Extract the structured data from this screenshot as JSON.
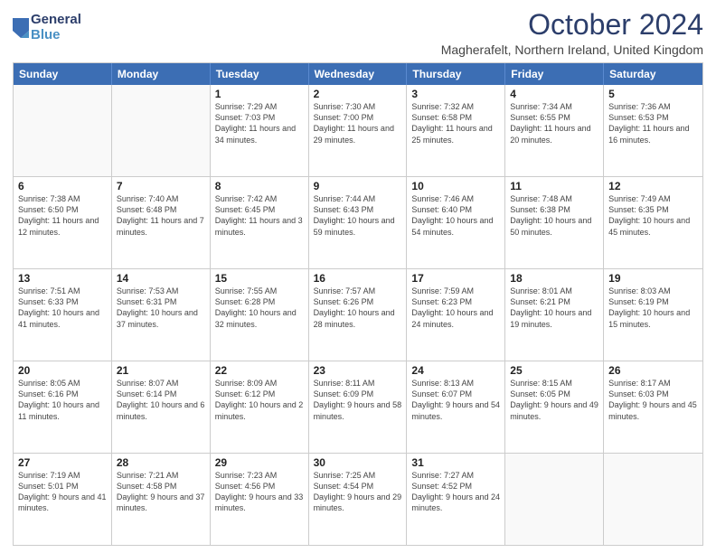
{
  "logo": {
    "general": "General",
    "blue": "Blue"
  },
  "title": "October 2024",
  "subtitle": "Magherafelt, Northern Ireland, United Kingdom",
  "headers": [
    "Sunday",
    "Monday",
    "Tuesday",
    "Wednesday",
    "Thursday",
    "Friday",
    "Saturday"
  ],
  "weeks": [
    [
      {
        "day": "",
        "sunrise": "",
        "sunset": "",
        "daylight": ""
      },
      {
        "day": "",
        "sunrise": "",
        "sunset": "",
        "daylight": ""
      },
      {
        "day": "1",
        "sunrise": "Sunrise: 7:29 AM",
        "sunset": "Sunset: 7:03 PM",
        "daylight": "Daylight: 11 hours and 34 minutes."
      },
      {
        "day": "2",
        "sunrise": "Sunrise: 7:30 AM",
        "sunset": "Sunset: 7:00 PM",
        "daylight": "Daylight: 11 hours and 29 minutes."
      },
      {
        "day": "3",
        "sunrise": "Sunrise: 7:32 AM",
        "sunset": "Sunset: 6:58 PM",
        "daylight": "Daylight: 11 hours and 25 minutes."
      },
      {
        "day": "4",
        "sunrise": "Sunrise: 7:34 AM",
        "sunset": "Sunset: 6:55 PM",
        "daylight": "Daylight: 11 hours and 20 minutes."
      },
      {
        "day": "5",
        "sunrise": "Sunrise: 7:36 AM",
        "sunset": "Sunset: 6:53 PM",
        "daylight": "Daylight: 11 hours and 16 minutes."
      }
    ],
    [
      {
        "day": "6",
        "sunrise": "Sunrise: 7:38 AM",
        "sunset": "Sunset: 6:50 PM",
        "daylight": "Daylight: 11 hours and 12 minutes."
      },
      {
        "day": "7",
        "sunrise": "Sunrise: 7:40 AM",
        "sunset": "Sunset: 6:48 PM",
        "daylight": "Daylight: 11 hours and 7 minutes."
      },
      {
        "day": "8",
        "sunrise": "Sunrise: 7:42 AM",
        "sunset": "Sunset: 6:45 PM",
        "daylight": "Daylight: 11 hours and 3 minutes."
      },
      {
        "day": "9",
        "sunrise": "Sunrise: 7:44 AM",
        "sunset": "Sunset: 6:43 PM",
        "daylight": "Daylight: 10 hours and 59 minutes."
      },
      {
        "day": "10",
        "sunrise": "Sunrise: 7:46 AM",
        "sunset": "Sunset: 6:40 PM",
        "daylight": "Daylight: 10 hours and 54 minutes."
      },
      {
        "day": "11",
        "sunrise": "Sunrise: 7:48 AM",
        "sunset": "Sunset: 6:38 PM",
        "daylight": "Daylight: 10 hours and 50 minutes."
      },
      {
        "day": "12",
        "sunrise": "Sunrise: 7:49 AM",
        "sunset": "Sunset: 6:35 PM",
        "daylight": "Daylight: 10 hours and 45 minutes."
      }
    ],
    [
      {
        "day": "13",
        "sunrise": "Sunrise: 7:51 AM",
        "sunset": "Sunset: 6:33 PM",
        "daylight": "Daylight: 10 hours and 41 minutes."
      },
      {
        "day": "14",
        "sunrise": "Sunrise: 7:53 AM",
        "sunset": "Sunset: 6:31 PM",
        "daylight": "Daylight: 10 hours and 37 minutes."
      },
      {
        "day": "15",
        "sunrise": "Sunrise: 7:55 AM",
        "sunset": "Sunset: 6:28 PM",
        "daylight": "Daylight: 10 hours and 32 minutes."
      },
      {
        "day": "16",
        "sunrise": "Sunrise: 7:57 AM",
        "sunset": "Sunset: 6:26 PM",
        "daylight": "Daylight: 10 hours and 28 minutes."
      },
      {
        "day": "17",
        "sunrise": "Sunrise: 7:59 AM",
        "sunset": "Sunset: 6:23 PM",
        "daylight": "Daylight: 10 hours and 24 minutes."
      },
      {
        "day": "18",
        "sunrise": "Sunrise: 8:01 AM",
        "sunset": "Sunset: 6:21 PM",
        "daylight": "Daylight: 10 hours and 19 minutes."
      },
      {
        "day": "19",
        "sunrise": "Sunrise: 8:03 AM",
        "sunset": "Sunset: 6:19 PM",
        "daylight": "Daylight: 10 hours and 15 minutes."
      }
    ],
    [
      {
        "day": "20",
        "sunrise": "Sunrise: 8:05 AM",
        "sunset": "Sunset: 6:16 PM",
        "daylight": "Daylight: 10 hours and 11 minutes."
      },
      {
        "day": "21",
        "sunrise": "Sunrise: 8:07 AM",
        "sunset": "Sunset: 6:14 PM",
        "daylight": "Daylight: 10 hours and 6 minutes."
      },
      {
        "day": "22",
        "sunrise": "Sunrise: 8:09 AM",
        "sunset": "Sunset: 6:12 PM",
        "daylight": "Daylight: 10 hours and 2 minutes."
      },
      {
        "day": "23",
        "sunrise": "Sunrise: 8:11 AM",
        "sunset": "Sunset: 6:09 PM",
        "daylight": "Daylight: 9 hours and 58 minutes."
      },
      {
        "day": "24",
        "sunrise": "Sunrise: 8:13 AM",
        "sunset": "Sunset: 6:07 PM",
        "daylight": "Daylight: 9 hours and 54 minutes."
      },
      {
        "day": "25",
        "sunrise": "Sunrise: 8:15 AM",
        "sunset": "Sunset: 6:05 PM",
        "daylight": "Daylight: 9 hours and 49 minutes."
      },
      {
        "day": "26",
        "sunrise": "Sunrise: 8:17 AM",
        "sunset": "Sunset: 6:03 PM",
        "daylight": "Daylight: 9 hours and 45 minutes."
      }
    ],
    [
      {
        "day": "27",
        "sunrise": "Sunrise: 7:19 AM",
        "sunset": "Sunset: 5:01 PM",
        "daylight": "Daylight: 9 hours and 41 minutes."
      },
      {
        "day": "28",
        "sunrise": "Sunrise: 7:21 AM",
        "sunset": "Sunset: 4:58 PM",
        "daylight": "Daylight: 9 hours and 37 minutes."
      },
      {
        "day": "29",
        "sunrise": "Sunrise: 7:23 AM",
        "sunset": "Sunset: 4:56 PM",
        "daylight": "Daylight: 9 hours and 33 minutes."
      },
      {
        "day": "30",
        "sunrise": "Sunrise: 7:25 AM",
        "sunset": "Sunset: 4:54 PM",
        "daylight": "Daylight: 9 hours and 29 minutes."
      },
      {
        "day": "31",
        "sunrise": "Sunrise: 7:27 AM",
        "sunset": "Sunset: 4:52 PM",
        "daylight": "Daylight: 9 hours and 24 minutes."
      },
      {
        "day": "",
        "sunrise": "",
        "sunset": "",
        "daylight": ""
      },
      {
        "day": "",
        "sunrise": "",
        "sunset": "",
        "daylight": ""
      }
    ]
  ]
}
